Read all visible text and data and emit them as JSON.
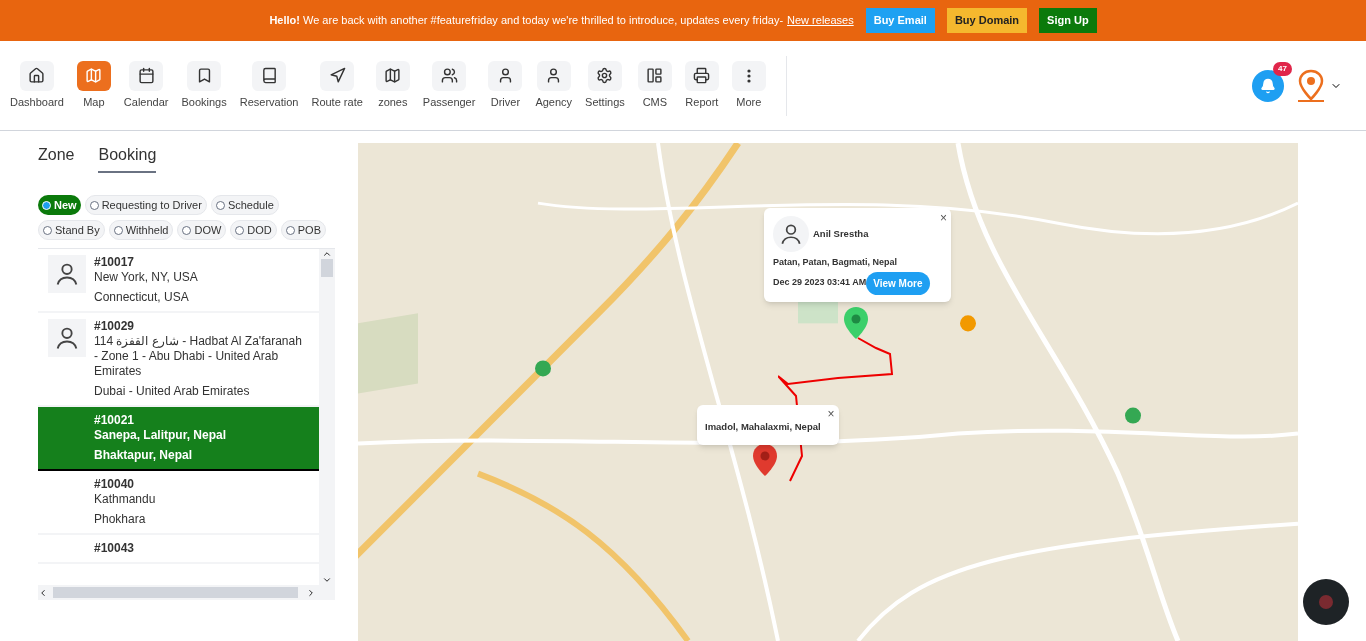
{
  "banner": {
    "message": "**Hello!** We are back with another #featurefriday and today we're thrilled to introduce, updates every friday-",
    "link": "New releases",
    "buttons": [
      {
        "label": "Buy Email",
        "kind": "blue"
      },
      {
        "label": "Buy Domain",
        "kind": "yellow"
      },
      {
        "label": "Sign Up",
        "kind": "green"
      }
    ]
  },
  "nav": [
    {
      "label": "Dashboard",
      "selected": false
    },
    {
      "label": "Map",
      "selected": true
    },
    {
      "label": "Calendar",
      "selected": false
    },
    {
      "label": "Bookings",
      "selected": false
    },
    {
      "label": "Reservation",
      "selected": false
    },
    {
      "label": "Route rate",
      "selected": false
    },
    {
      "label": "zones",
      "selected": false
    },
    {
      "label": "Passenger",
      "selected": false
    },
    {
      "label": "Driver",
      "selected": false
    },
    {
      "label": "Agency",
      "selected": false
    },
    {
      "label": "Settings",
      "selected": false
    },
    {
      "label": "CMS",
      "selected": false
    },
    {
      "label": "Report",
      "selected": false
    },
    {
      "label": "More",
      "selected": false
    }
  ],
  "notifications": {
    "count": "47"
  },
  "tabs": [
    {
      "label": "Zone",
      "selected": false
    },
    {
      "label": "Booking",
      "selected": true
    }
  ],
  "filters": [
    {
      "label": "New",
      "selected": true
    },
    {
      "label": "Requesting to Driver",
      "selected": false
    },
    {
      "label": "Schedule",
      "selected": false
    },
    {
      "label": "Stand By",
      "selected": false
    },
    {
      "label": "Withheld",
      "selected": false
    },
    {
      "label": "DOW",
      "selected": false
    },
    {
      "label": "DOD",
      "selected": false
    },
    {
      "label": "POB",
      "selected": false
    }
  ],
  "bookings": [
    {
      "id": "#10017",
      "pickup": "New York, NY, USA",
      "dropoff": "Connecticut, USA",
      "avatar": true,
      "selected": false
    },
    {
      "id": "#10029",
      "pickup": "114 شارع القفزة - Hadbat Al Za'faranah - Zone 1 - Abu Dhabi - United Arab Emirates",
      "dropoff": "Dubai - United Arab Emirates",
      "avatar": true,
      "selected": false
    },
    {
      "id": "#10021",
      "pickup": "Sanepa, Lalitpur, Nepal",
      "dropoff": "Bhaktapur, Nepal",
      "avatar": false,
      "selected": true
    },
    {
      "id": "#10040",
      "pickup": "Kathmandu",
      "dropoff": "Phokhara",
      "avatar": false,
      "selected": false
    },
    {
      "id": "#10043",
      "avatar": false,
      "selected": false
    }
  ],
  "map": {
    "driver_popup": {
      "name": "Anil Srestha",
      "address": "Patan, Patan, Bagmati, Nepal",
      "time": "Dec 29 2023 03:41 AM",
      "button": "View More",
      "close": "×"
    },
    "destination_popup": {
      "address": "Imadol, Mahalaxmi, Nepal",
      "close": "×"
    }
  }
}
